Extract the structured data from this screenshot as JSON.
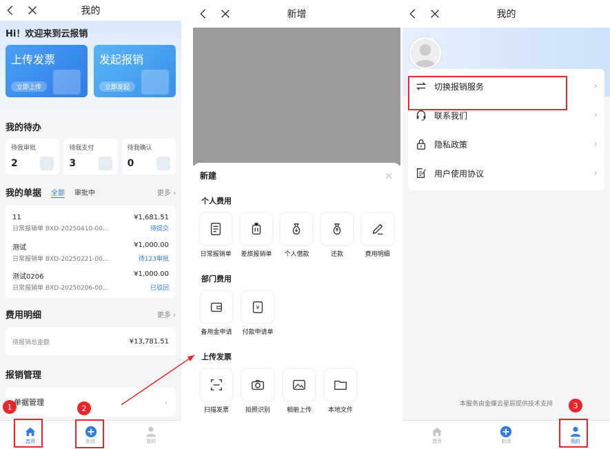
{
  "panel1": {
    "title": "我的",
    "greeting": "Hi！欢迎来到云报销",
    "card_upload": {
      "title": "上传发票",
      "button": "立即上传"
    },
    "card_claim": {
      "title": "发起报销",
      "button": "立即发起"
    },
    "todo_title": "我的待办",
    "todos": [
      {
        "label": "待我审批",
        "count": "2"
      },
      {
        "label": "待我支付",
        "count": "3"
      },
      {
        "label": "待我确认",
        "count": "0"
      }
    ],
    "bills_title": "我的单据",
    "bills_tab_all": "全部",
    "bills_tab_pending": "审批中",
    "more": "更多",
    "bills": [
      {
        "name": "11",
        "amount": "¥1,681.51",
        "sub": "日常报销单 BXD-20250410-00...",
        "status": "待提交"
      },
      {
        "name": "测试",
        "amount": "¥1,000.00",
        "sub": "日常报销单 BXD-20250221-00...",
        "status": "待123审批"
      },
      {
        "name": "测试0206",
        "amount": "¥1,000.00",
        "sub": "日常报销单 BXD-20250206-00...",
        "status": "已驳回"
      }
    ],
    "fee_title": "费用明细",
    "fee_label": "待报销总金额",
    "fee_value": "¥13,781.51",
    "manage_title": "报销管理",
    "manage_item": "单据管理"
  },
  "tabbar": {
    "home": "首页",
    "add": "新增",
    "mine": "我的"
  },
  "badges": {
    "b1": "1",
    "b2": "2",
    "b3": "3"
  },
  "panel2": {
    "title": "新增",
    "sheet_title": "新建",
    "groups": [
      {
        "title": "个人费用",
        "items": [
          {
            "label": "日常报销单",
            "icon": "receipt-icon"
          },
          {
            "label": "差旅报销单",
            "icon": "luggage-icon"
          },
          {
            "label": "个人借款",
            "icon": "money-bag-down-icon"
          },
          {
            "label": "还款",
            "icon": "money-bag-up-icon"
          },
          {
            "label": "费用明细",
            "icon": "pencil-icon"
          }
        ]
      },
      {
        "title": "部门费用",
        "items": [
          {
            "label": "备用金申请",
            "icon": "wallet-icon"
          },
          {
            "label": "付款申请单",
            "icon": "yuan-doc-icon"
          }
        ]
      },
      {
        "title": "上传发票",
        "items": [
          {
            "label": "扫描发票",
            "icon": "scan-icon"
          },
          {
            "label": "拍照识别",
            "icon": "camera-icon"
          },
          {
            "label": "相册上传",
            "icon": "image-icon"
          },
          {
            "label": "本地文件",
            "icon": "folder-icon"
          }
        ]
      }
    ]
  },
  "panel3": {
    "title": "我的",
    "menu": [
      {
        "label": "切换报销服务",
        "icon": "switch-icon"
      },
      {
        "label": "联系我们",
        "icon": "headset-icon"
      },
      {
        "label": "隐私政策",
        "icon": "lock-icon"
      },
      {
        "label": "用户使用协议",
        "icon": "doc-edit-icon"
      }
    ],
    "footer": "本服务由金蝶云星辰提供技术支持"
  },
  "colors": {
    "accent": "#2f7ce6",
    "annotation": "#e8262a"
  }
}
